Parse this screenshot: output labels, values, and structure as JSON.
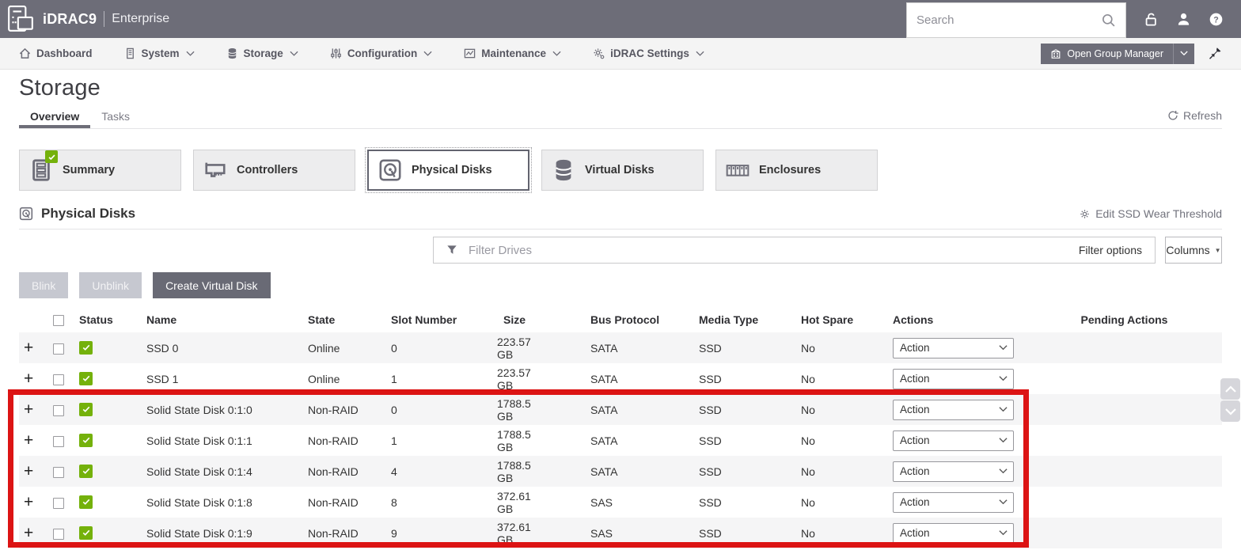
{
  "header": {
    "brand": "iDRAC9",
    "edition": "Enterprise",
    "search_placeholder": "Search"
  },
  "nav": {
    "items": [
      {
        "label": "Dashboard",
        "icon": "home-icon",
        "has_dropdown": false
      },
      {
        "label": "System",
        "icon": "system-icon",
        "has_dropdown": true
      },
      {
        "label": "Storage",
        "icon": "storage-icon",
        "has_dropdown": true
      },
      {
        "label": "Configuration",
        "icon": "configuration-icon",
        "has_dropdown": true
      },
      {
        "label": "Maintenance",
        "icon": "maintenance-icon",
        "has_dropdown": true
      },
      {
        "label": "iDRAC Settings",
        "icon": "idrac-settings-icon",
        "has_dropdown": true
      }
    ],
    "group_manager_label": "Open Group Manager"
  },
  "page": {
    "title": "Storage",
    "tabs": [
      {
        "label": "Overview",
        "active": true
      },
      {
        "label": "Tasks",
        "active": false
      }
    ],
    "refresh_label": "Refresh"
  },
  "cards": [
    {
      "label": "Summary",
      "icon": "summary-icon",
      "selected": false,
      "badge": "green-check"
    },
    {
      "label": "Controllers",
      "icon": "controllers-icon",
      "selected": false,
      "badge": null
    },
    {
      "label": "Physical Disks",
      "icon": "physical-disks-icon",
      "selected": true,
      "badge": null
    },
    {
      "label": "Virtual Disks",
      "icon": "virtual-disks-icon",
      "selected": false,
      "badge": null
    },
    {
      "label": "Enclosures",
      "icon": "enclosures-icon",
      "selected": false,
      "badge": null
    }
  ],
  "section": {
    "title": "Physical Disks",
    "edit_ssd_label": "Edit SSD Wear Threshold"
  },
  "filter": {
    "placeholder": "Filter Drives",
    "options_label": "Filter options",
    "columns_label": "Columns"
  },
  "toolbar": {
    "blink_label": "Blink",
    "unblink_label": "Unblink",
    "create_vd_label": "Create Virtual Disk"
  },
  "table": {
    "columns": [
      "Status",
      "Name",
      "State",
      "Slot Number",
      "Size",
      "Bus Protocol",
      "Media Type",
      "Hot Spare",
      "Actions",
      "Pending Actions"
    ],
    "action_label": "Action",
    "rows": [
      {
        "status": "ok",
        "name": "SSD 0",
        "state": "Online",
        "slot": "0",
        "size": "223.57 GB",
        "bus": "SATA",
        "media": "SSD",
        "hot_spare": "No",
        "pending": ""
      },
      {
        "status": "ok",
        "name": "SSD 1",
        "state": "Online",
        "slot": "1",
        "size": "223.57 GB",
        "bus": "SATA",
        "media": "SSD",
        "hot_spare": "No",
        "pending": ""
      },
      {
        "status": "ok",
        "name": "Solid State Disk 0:1:0",
        "state": "Non-RAID",
        "slot": "0",
        "size": "1788.5 GB",
        "bus": "SATA",
        "media": "SSD",
        "hot_spare": "No",
        "pending": ""
      },
      {
        "status": "ok",
        "name": "Solid State Disk 0:1:1",
        "state": "Non-RAID",
        "slot": "1",
        "size": "1788.5 GB",
        "bus": "SATA",
        "media": "SSD",
        "hot_spare": "No",
        "pending": ""
      },
      {
        "status": "ok",
        "name": "Solid State Disk 0:1:4",
        "state": "Non-RAID",
        "slot": "4",
        "size": "1788.5 GB",
        "bus": "SATA",
        "media": "SSD",
        "hot_spare": "No",
        "pending": ""
      },
      {
        "status": "ok",
        "name": "Solid State Disk 0:1:8",
        "state": "Non-RAID",
        "slot": "8",
        "size": "372.61 GB",
        "bus": "SAS",
        "media": "SSD",
        "hot_spare": "No",
        "pending": ""
      },
      {
        "status": "ok",
        "name": "Solid State Disk 0:1:9",
        "state": "Non-RAID",
        "slot": "9",
        "size": "372.61 GB",
        "bus": "SAS",
        "media": "SSD",
        "hot_spare": "No",
        "pending": ""
      }
    ]
  },
  "highlight": {
    "description": "red annotation rectangle around the five Solid State Disk non-RAID rows",
    "color": "#dc1414",
    "row_start_index": 2,
    "row_end_index": 6
  },
  "colors": {
    "header_bg": "#6d6d78",
    "status_green": "#74b10b",
    "highlight_red": "#dc1414"
  }
}
